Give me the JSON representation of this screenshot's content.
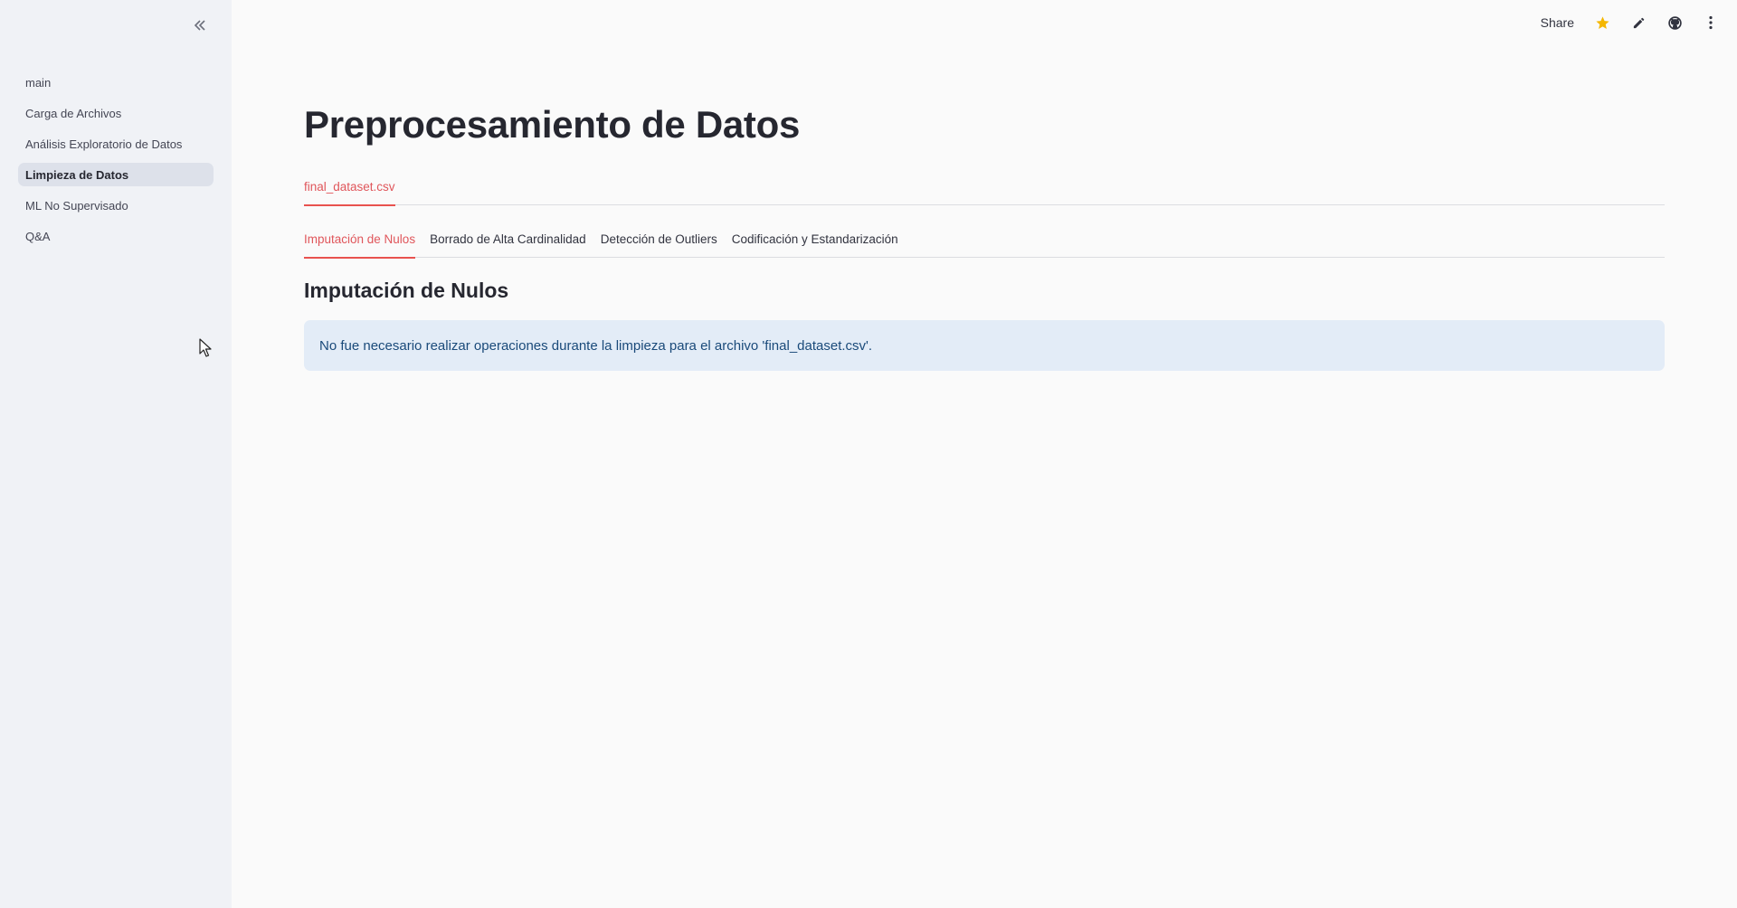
{
  "sidebar": {
    "collapse_icon": "double-chevron-left-icon",
    "items": [
      {
        "label": "main",
        "active": false
      },
      {
        "label": "Carga de Archivos",
        "active": false
      },
      {
        "label": "Análisis Exploratorio de Datos",
        "active": false
      },
      {
        "label": "Limpieza de Datos",
        "active": true
      },
      {
        "label": "ML No Supervisado",
        "active": false
      },
      {
        "label": "Q&A",
        "active": false
      }
    ]
  },
  "header": {
    "share_label": "Share",
    "icons": [
      "star-icon",
      "pencil-icon",
      "github-icon",
      "kebab-menu-icon"
    ]
  },
  "main": {
    "title": "Preprocesamiento de Datos",
    "file_tabs": [
      {
        "label": "final_dataset.csv",
        "active": true
      }
    ],
    "sub_tabs": [
      {
        "label": "Imputación de Nulos",
        "active": true
      },
      {
        "label": "Borrado de Alta Cardinalidad",
        "active": false
      },
      {
        "label": "Detección de Outliers",
        "active": false
      },
      {
        "label": "Codificación y Estandarización",
        "active": false
      }
    ],
    "subheading": "Imputación de Nulos",
    "info_message": "No fue necesario realizar operaciones durante la limpieza para el archivo 'final_dataset.csv'."
  },
  "colors": {
    "accent": "#e8524f",
    "sidebar_bg": "#f0f2f6",
    "info_bg": "#e3ecf7",
    "star": "#f5b700"
  }
}
